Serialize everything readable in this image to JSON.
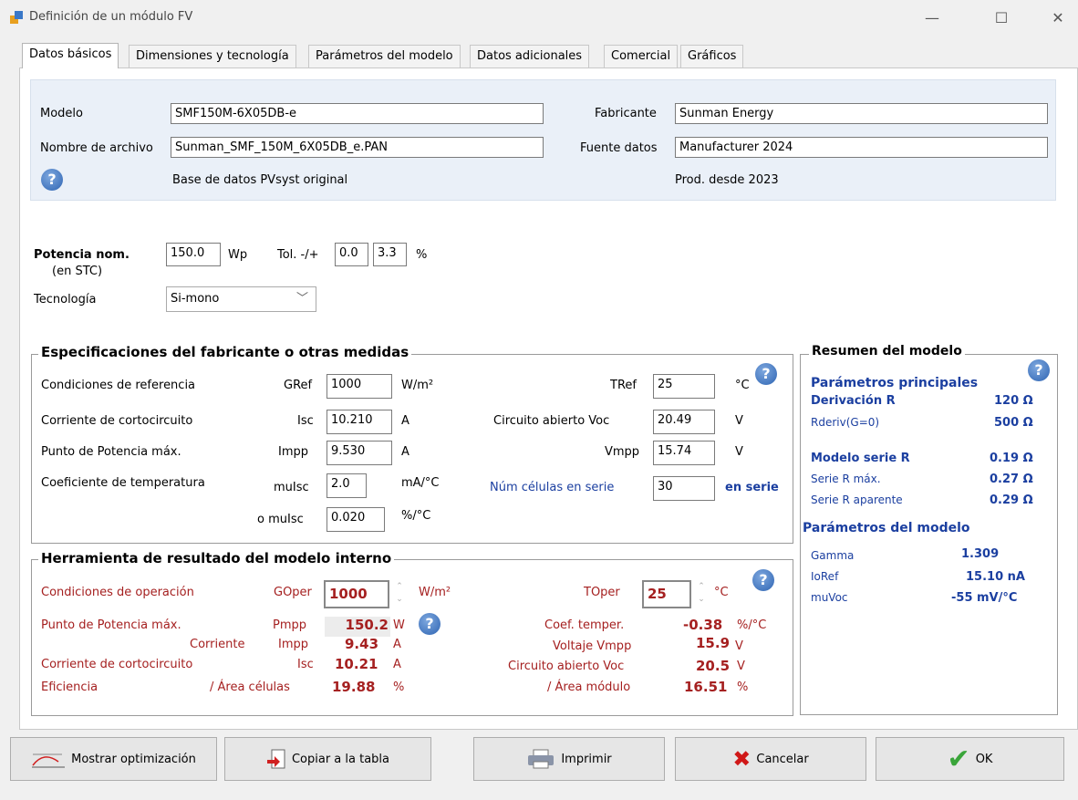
{
  "window": {
    "title": "Definición de un módulo FV",
    "minimize": "—",
    "maximize": "☐",
    "close": "✕"
  },
  "tabs": [
    "Datos básicos",
    "Dimensiones y tecnología",
    "Parámetros del modelo",
    "Datos adicionales",
    "Comercial",
    "Gráficos"
  ],
  "header": {
    "modelo_label": "Modelo",
    "modelo_value": "SMF150M-6X05DB-e",
    "archivo_label": "Nombre de archivo",
    "archivo_value": "Sunman_SMF_150M_6X05DB_e.PAN",
    "fabricante_label": "Fabricante",
    "fabricante_value": "Sunman Energy",
    "fuente_label": "Fuente datos",
    "fuente_value": "Manufacturer 2024",
    "base_text": "Base de datos PVsyst original",
    "prod_text": "Prod. desde 2023"
  },
  "power": {
    "label": "Potencia nom.",
    "sub": "(en STC)",
    "value": "150.0",
    "unit": "Wp",
    "tol_label": "Tol. -/+",
    "tol_minus": "0.0",
    "tol_plus": "3.3",
    "tol_unit": "%",
    "tech_label": "Tecnología",
    "tech_value": "Si-mono"
  },
  "specs": {
    "title": "Especificaciones del fabricante o otras medidas",
    "rows": [
      {
        "label": "Condiciones de referencia",
        "sym": "GRef",
        "value": "1000",
        "unit": "W/m²"
      },
      {
        "label": "Corriente de cortocircuito",
        "sym": "Isc",
        "value": "10.210",
        "unit": "A"
      },
      {
        "label": "Punto de Potencia máx.",
        "sym": "Impp",
        "value": "9.530",
        "unit": "A"
      },
      {
        "label": "Coeficiente de temperatura",
        "sym": "muIsc",
        "value": "2.0",
        "unit": "mA/°C"
      },
      {
        "label": "",
        "sym": "o muIsc",
        "value": "0.020",
        "unit": "%/°C"
      }
    ],
    "right": [
      {
        "sym": "TRef",
        "value": "25",
        "unit": "°C"
      },
      {
        "sym": "Circuito abierto Voc",
        "value": "20.49",
        "unit": "V"
      },
      {
        "sym": "Vmpp",
        "value": "15.74",
        "unit": "V"
      },
      {
        "sym": "Núm células en serie",
        "value": "30",
        "unit": "en serie"
      }
    ]
  },
  "tool": {
    "title": "Herramienta de resultado del modelo interno",
    "oper_label": "Condiciones de operación",
    "goper_sym": "GOper",
    "goper_value": "1000",
    "goper_unit": "W/m²",
    "toper_sym": "TOper",
    "toper_value": "25",
    "toper_unit": "°C",
    "pmpp_label": "Punto de Potencia máx.",
    "pmpp_sym": "Pmpp",
    "pmpp_value": "150.2",
    "pmpp_unit": "W",
    "corr_label": "Corriente",
    "impp_sym": "Impp",
    "impp_value": "9.43",
    "impp_unit": "A",
    "isc_label": "Corriente de cortocircuito",
    "isc_sym": "Isc",
    "isc_value": "10.21",
    "isc_unit": "A",
    "ef_label": "Eficiencia",
    "ef_cells_label": "/ Área células",
    "ef_cells_value": "19.88",
    "ef_unit": "%",
    "coef_label": "Coef. temper.",
    "coef_value": "-0.38",
    "coef_unit": "%/°C",
    "vmpp_label": "Voltaje Vmpp",
    "vmpp_value": "15.9",
    "vmpp_unit": "V",
    "voc_label": "Circuito abierto Voc",
    "voc_value": "20.5",
    "voc_unit": "V",
    "ef_mod_label": "/ Área módulo",
    "ef_mod_value": "16.51",
    "ef_mod_unit": "%"
  },
  "summary": {
    "title": "Resumen del modelo",
    "main_title": "Parámetros principales",
    "deriv_label": "Derivación R",
    "deriv_value": "120 Ω",
    "rderiv_label": "Rderiv(G=0)",
    "rderiv_value": "500 Ω",
    "serie_label": "Modelo serie R",
    "serie_value": "0.19 Ω",
    "seriemax_label": "Serie R máx.",
    "seriemax_value": "0.27 Ω",
    "serieap_label": "Serie R aparente",
    "serieap_value": "0.29 Ω",
    "model_title": "Parámetros del modelo",
    "gamma_label": "Gamma",
    "gamma_value": "1.309",
    "ioref_label": "IoRef",
    "ioref_value": "15.10 nA",
    "muvoc_label": "muVoc",
    "muvoc_value": "-55 mV/°C"
  },
  "buttons": {
    "optim": "Mostrar optimización",
    "copy": "Copiar a la tabla",
    "print": "Imprimir",
    "cancel": "Cancelar",
    "ok": "OK"
  },
  "colors": {
    "accent_red": "#a52020",
    "accent_blue": "#1b3fa0",
    "header_bg": "#eaf0f8"
  }
}
